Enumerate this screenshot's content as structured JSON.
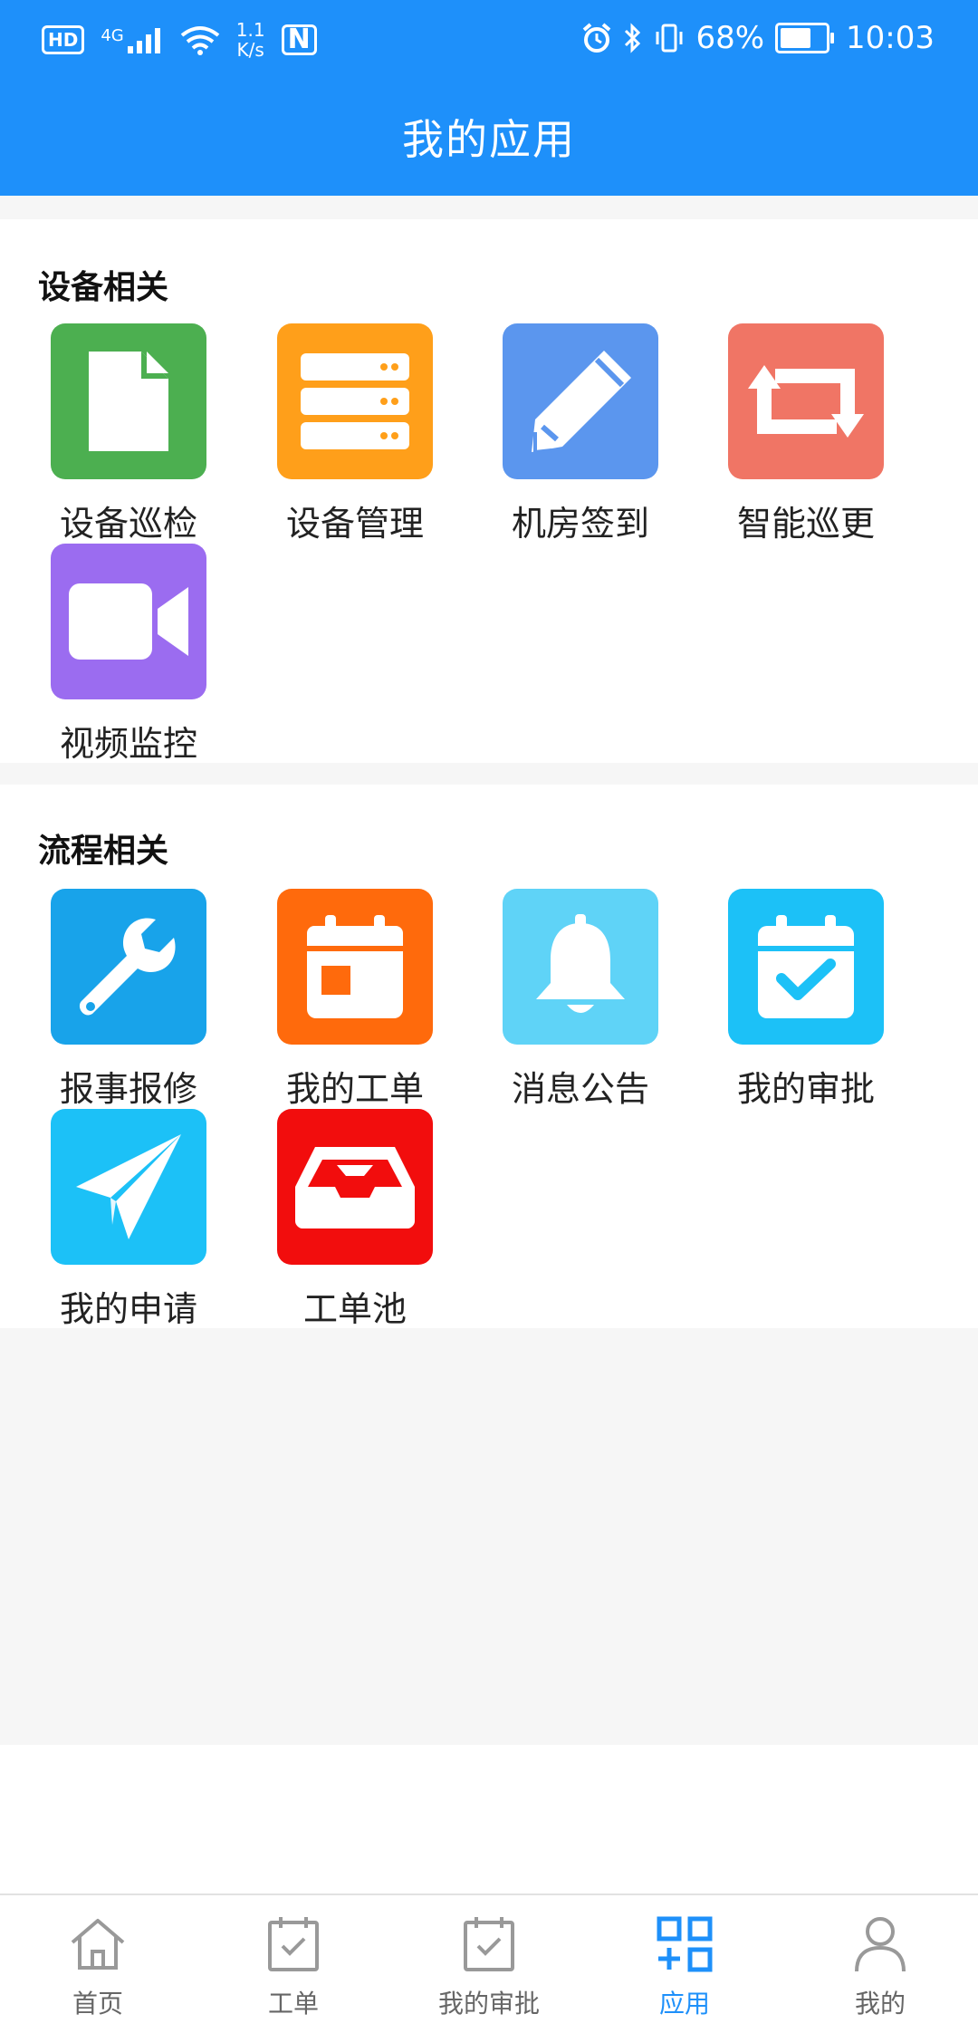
{
  "status_bar": {
    "hd": "HD",
    "network": "4G",
    "speed_value": "1.1",
    "speed_unit": "K/s",
    "nfc": "N",
    "battery_percent": "68%",
    "battery_level": 0.68,
    "time": "10:03"
  },
  "header": {
    "title": "我的应用"
  },
  "sections": [
    {
      "title": "设备相关",
      "tiles": [
        {
          "label": "设备巡检",
          "color": "#4caf50",
          "icon": "document-icon"
        },
        {
          "label": "设备管理",
          "color": "#ff9f1a",
          "icon": "server-icon"
        },
        {
          "label": "机房签到",
          "color": "#5b96ee",
          "icon": "pencil-icon"
        },
        {
          "label": "智能巡更",
          "color": "#f07565",
          "icon": "repeat-icon"
        },
        {
          "label": "视频监控",
          "color": "#9b6cf0",
          "icon": "video-camera-icon"
        }
      ]
    },
    {
      "title": "流程相关",
      "tiles": [
        {
          "label": "报事报修",
          "color": "#18a3ea",
          "icon": "wrench-icon"
        },
        {
          "label": "我的工单",
          "color": "#ff6a0c",
          "icon": "calendar-icon"
        },
        {
          "label": "消息公告",
          "color": "#5fd3f7",
          "icon": "bell-icon"
        },
        {
          "label": "我的审批",
          "color": "#1cc1f7",
          "icon": "calendar-check-icon"
        },
        {
          "label": "我的申请",
          "color": "#1cc1f7",
          "icon": "paper-plane-icon"
        },
        {
          "label": "工单池",
          "color": "#f20d0d",
          "icon": "inbox-icon"
        }
      ]
    }
  ],
  "bottom_nav": {
    "items": [
      {
        "label": "首页",
        "icon": "home-icon"
      },
      {
        "label": "工单",
        "icon": "calendar-check-icon"
      },
      {
        "label": "我的审批",
        "icon": "calendar-check-icon"
      },
      {
        "label": "应用",
        "icon": "apps-icon",
        "active": true
      },
      {
        "label": "我的",
        "icon": "user-icon"
      }
    ],
    "active_color": "#1e90fa",
    "inactive_color": "#999999"
  }
}
